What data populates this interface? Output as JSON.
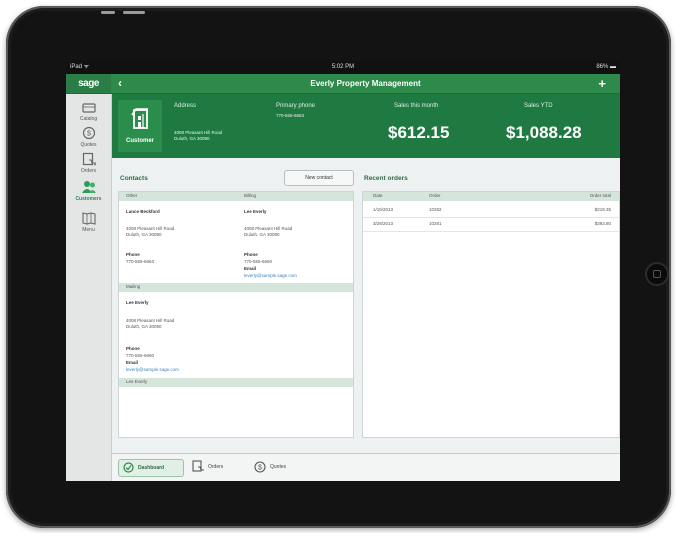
{
  "status_bar": {
    "carrier": "iPad ᯤ",
    "time": "5:02 PM",
    "battery": "86% ▬"
  },
  "nav": {
    "logo": "sage",
    "back": "‹",
    "title": "Everly Property Management",
    "add": "+"
  },
  "sidebar": {
    "items": [
      {
        "label": "Catalog",
        "icon": "catalog-icon"
      },
      {
        "label": "Quotes",
        "icon": "quotes-icon"
      },
      {
        "label": "Orders",
        "icon": "orders-icon"
      },
      {
        "label": "Customers",
        "icon": "customers-icon",
        "active": true
      },
      {
        "label": "Menu",
        "icon": "menu-icon"
      }
    ]
  },
  "header": {
    "badge_label": "Customer",
    "address_label": "Address",
    "address_line1": "4008 Pleasant Hill Road",
    "address_line2": "Duluth, GA 30090",
    "phone_label": "Primary phone",
    "phone_value": "770-555-6663",
    "sales_month_label": "Sales this month",
    "sales_month_value": "$612.15",
    "sales_ytd_label": "Sales YTD",
    "sales_ytd_value": "$1,088.28"
  },
  "contacts": {
    "title": "Contacts",
    "new_button": "New contact",
    "other_header": "Other",
    "billing_header": "Billing",
    "other": {
      "name": "Lance Beckford",
      "addr1": "4008 Pleasant Hill Road",
      "addr2": "Duluth, GA 30090",
      "phone_label": "Phone",
      "phone": "770-555-6663"
    },
    "billing": {
      "name": "Lee Everly",
      "addr1": "4008 Pleasant Hill Road",
      "addr2": "Duluth, GA 30090",
      "phone_label": "Phone",
      "phone": "770-555-6660",
      "email_label": "Email",
      "email": "leverly@sample.sage.com"
    },
    "mailing_header": "Mailing",
    "mailing": {
      "name": "Lee Everly",
      "addr1": "4008 Pleasant Hill Road",
      "addr2": "Duluth, GA 30090",
      "phone_label": "Phone",
      "phone": "770-555-6660",
      "email_label": "Email",
      "email": "leverly@sample.sage.com"
    },
    "next_header": "Lee Everly"
  },
  "orders": {
    "title": "Recent orders",
    "headers": {
      "date": "Date",
      "order": "Order",
      "total": "Order total"
    },
    "rows": [
      {
        "date": "1/15/2013",
        "order": "10282",
        "total": "$218.35"
      },
      {
        "date": "3/28/2013",
        "order": "10281",
        "total": "$393.80"
      }
    ]
  },
  "toolbar": {
    "dashboard": "Dashboard",
    "orders": "Orders",
    "quotes": "Quotes"
  },
  "colors": {
    "brand_green": "#2e8a4b",
    "header_green": "#1f7a42",
    "link_blue": "#3a7fbf"
  }
}
